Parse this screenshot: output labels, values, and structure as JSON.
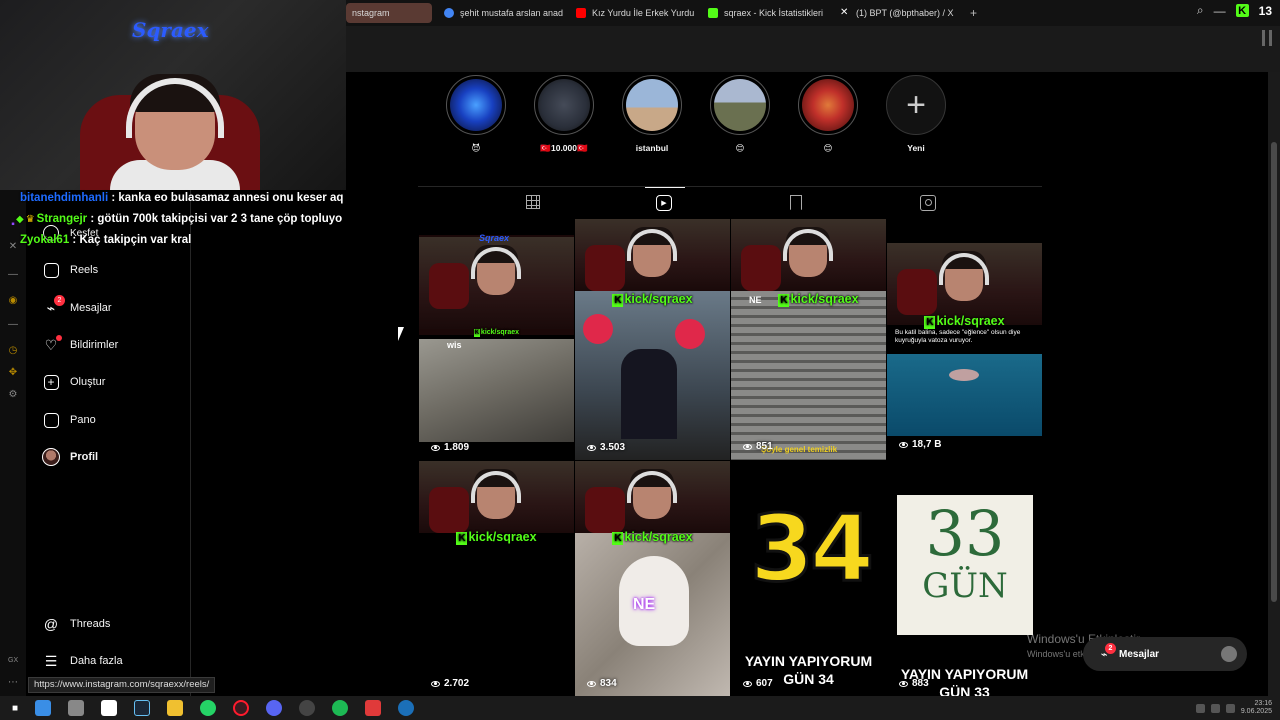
{
  "browser": {
    "tabs": [
      {
        "label": "nstagram",
        "active": true,
        "color": "#8a5a4a"
      },
      {
        "label": "şehit mustafa arslan anad",
        "active": false,
        "color": "#4285f4"
      },
      {
        "label": "Kız Yurdu İle Erkek Yurdu",
        "active": false,
        "color": "#ff0000"
      },
      {
        "label": "sqraex - Kick İstatistikleri",
        "active": false,
        "color": "#53fc18"
      },
      {
        "label": "(1) BPT (@bpthaber) / X",
        "active": false,
        "color": "#ffffff"
      }
    ],
    "new_tab": "+",
    "kick_count": "13",
    "kick_letter": "K"
  },
  "overlay": {
    "cam_logo": "Sqraex",
    "chat": [
      {
        "badges": "",
        "user": "bitanehdimhanli",
        "text": " : kanka eo bulasamaz annesi onu keser aq",
        "user_color": "#1e6bff"
      },
      {
        "badges": "◆",
        "user": "Strangejr",
        "text": " : götün 700k takipçisi var 2 3 tane çöp topluyo",
        "user_color": "#53fc18"
      },
      {
        "badges": "",
        "user": "Zyokal61",
        "text": " : Kaç takipçin var kral",
        "user_color": "#53fc18"
      }
    ]
  },
  "sidebar": {
    "items": [
      {
        "label": "Keşfet",
        "icon": "compass-icon"
      },
      {
        "label": "Reels",
        "icon": "reels-icon"
      },
      {
        "label": "Mesajlar",
        "icon": "messenger-icon",
        "badge": "2"
      },
      {
        "label": "Bildirimler",
        "icon": "heart-icon"
      },
      {
        "label": "Oluştur",
        "icon": "create-icon"
      },
      {
        "label": "Pano",
        "icon": "dashboard-icon"
      },
      {
        "label": "Profil",
        "icon": "avatar"
      }
    ],
    "threads": "Threads",
    "more": "Daha fazla"
  },
  "hover_url": "https://www.instagram.com/sqraexx/reels/",
  "stories": [
    {
      "label": "😈",
      "color": "#1840c0"
    },
    {
      "label": "🇹🇷10.000🇹🇷",
      "color": "#2a2f3a"
    },
    {
      "label": "istanbul",
      "color": "#8aa4c8"
    },
    {
      "label": "😊",
      "color": "#7b8aa8"
    },
    {
      "label": "😊",
      "color": "#c0302a"
    }
  ],
  "new_story": {
    "label": "Yeni"
  },
  "profile_tabs": [
    "grid-icon",
    "reels-tab-icon",
    "saved-icon",
    "tagged-icon"
  ],
  "reels": [
    {
      "views": "1.809",
      "kick": "kick/sqraex",
      "badge": "wis"
    },
    {
      "views": "3.503",
      "kick": "kick/sqraex"
    },
    {
      "views": "851",
      "kick": "kick/sqraex",
      "tag": "NE",
      "caption": "Şöyle genel temizlik"
    },
    {
      "views": "18,7 B",
      "kick": "kick/sqraex",
      "caption": "Bu katil balina, sadece \"eğlence\" olsun diye kuyruğuyla vatoza vuruyor."
    },
    {
      "views": "2.702",
      "kick": "kick/sqraex"
    },
    {
      "views": "834",
      "kick": "kick/sqraex",
      "tag": "NE"
    },
    {
      "views": "607",
      "big": "34",
      "title1": "YAYIN YAPIYORUM",
      "title2": "GÜN 34"
    },
    {
      "views": "883",
      "big": "33",
      "big2": "GÜN",
      "title1": "YAYIN YAPIYORUM",
      "title2": "GÜN 33"
    }
  ],
  "floating": {
    "messages": "Mesajlar",
    "badge": "2",
    "watermark1": "Windows'u Etkinleştir",
    "watermark2": "Windows'u etkinleştirmek için Ayarlar'a gidin."
  },
  "taskbar": {
    "icons": [
      "#3a8ee6",
      "#888888",
      "#ffffff",
      "#1b2838",
      "#f0c030",
      "#25d366",
      "#ff1b2d",
      "#5865f2",
      "#cccccc",
      "#1db954",
      "#e03a3a",
      "#1b6fb8"
    ],
    "time": "23:16",
    "date": "9.06.2025"
  }
}
